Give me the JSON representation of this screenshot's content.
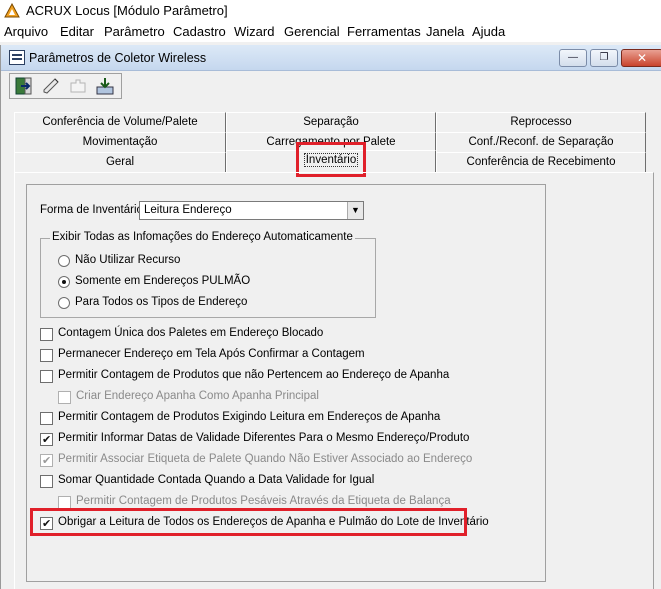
{
  "app": {
    "title": "ACRUX Locus [Módulo Parâmetro]"
  },
  "menu": [
    "Arquivo",
    "Editar",
    "Parâmetro",
    "Cadastro",
    "Wizard",
    "Gerencial",
    "Ferramentas",
    "Janela",
    "Ajuda"
  ],
  "window": {
    "title": "Parâmetros de Coletor Wireless",
    "controls": {
      "minimize": "—",
      "restore": "❐",
      "close": "✕"
    }
  },
  "toolbar": [
    "exit-icon",
    "edit-icon",
    "puzzle-icon",
    "save-icon"
  ],
  "tabs": {
    "row1": [
      "Conferência de Volume/Palete",
      "Separação",
      "Reprocesso"
    ],
    "row2": [
      "Movimentação",
      "Carregamento por Palete",
      "Conf./Reconf. de Separação"
    ],
    "row3": [
      "Geral",
      "Inventário",
      "Conferência de Recebimento"
    ],
    "active": "Inventário"
  },
  "form": {
    "forma_label": "Forma de Inventário",
    "forma_value": "Leitura Endereço",
    "group_title": "Exibir Todas as Infomações do Endereço Automaticamente",
    "radios": [
      {
        "label": "Não Utilizar Recurso",
        "selected": false
      },
      {
        "label": "Somente em Endereços PULMÃO",
        "selected": true
      },
      {
        "label": "Para Todos os Tipos de Endereço",
        "selected": false
      }
    ],
    "checks": [
      {
        "label": "Contagem Única dos Paletes em Endereço Blocado",
        "checked": false,
        "enabled": true
      },
      {
        "label": "Permanecer Endereço em Tela Após Confirmar a Contagem",
        "checked": false,
        "enabled": true
      },
      {
        "label": "Permitir Contagem de Produtos que não Pertencem ao Endereço de Apanha",
        "checked": false,
        "enabled": true
      },
      {
        "label": "Criar Endereço Apanha Como Apanha Principal",
        "checked": false,
        "enabled": false
      },
      {
        "label": "Permitir Contagem de Produtos Exigindo Leitura em Endereços de Apanha",
        "checked": false,
        "enabled": true
      },
      {
        "label": "Permitir Informar Datas de Validade Diferentes Para o Mesmo Endereço/Produto",
        "checked": true,
        "enabled": true
      },
      {
        "label": "Permitir Associar Etiqueta de Palete Quando Não Estiver Associado ao Endereço",
        "checked": true,
        "enabled": false
      },
      {
        "label": "Somar Quantidade Contada Quando a Data Validade for Igual",
        "checked": false,
        "enabled": true
      },
      {
        "label": "Permitir Contagem de Produtos Pesáveis Através da Etiqueta de Balança",
        "checked": false,
        "enabled": false
      },
      {
        "label": "Obrigar a Leitura de Todos os Endereços de Apanha e Pulmão do Lote de Inventário",
        "checked": true,
        "enabled": true
      }
    ]
  },
  "colors": {
    "highlight": "#e0202a",
    "title_gradient": "#c5d7ee"
  }
}
